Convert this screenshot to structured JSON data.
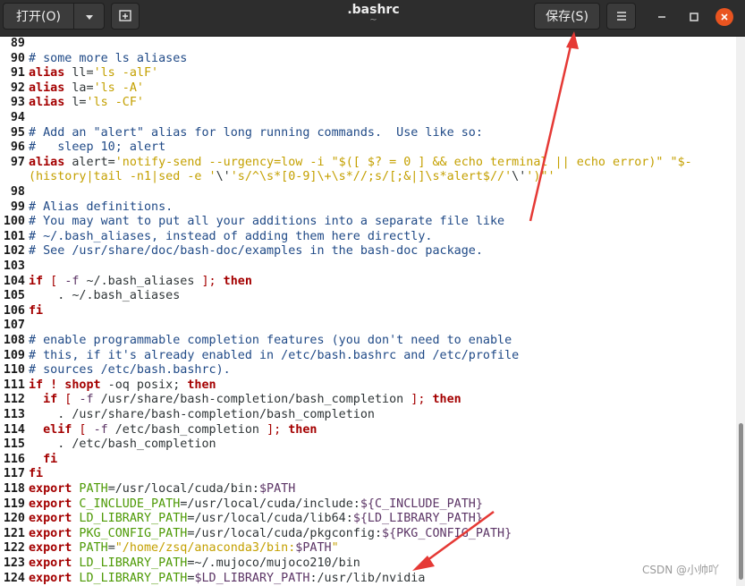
{
  "header": {
    "open_label": "打开(O)",
    "title": ".bashrc",
    "subtitle": "~",
    "save_label": "保存(S)"
  },
  "icons": {
    "open_dropdown": "chevron-down-icon",
    "new_tab": "new-tab-icon",
    "menu": "hamburger-menu-icon",
    "minimize": "minimize-icon",
    "maximize": "maximize-icon",
    "close": "close-icon"
  },
  "colors": {
    "titlebar": "#2d2d2d",
    "close_button": "#e95420",
    "arrow": "#e53935",
    "comment": "#204a87",
    "keyword": "#a40000",
    "string": "#c4a000",
    "variable": "#5c3566",
    "builtin": "#4e9a06"
  },
  "watermark": "CSDN @小帅吖",
  "lines": [
    {
      "n": "89",
      "t": []
    },
    {
      "n": "90",
      "t": [
        {
          "c": "c",
          "x": "# some more ls aliases"
        }
      ]
    },
    {
      "n": "91",
      "t": [
        {
          "c": "k",
          "x": "alias"
        },
        {
          "c": "",
          "x": " ll="
        },
        {
          "c": "s",
          "x": "'ls -alF'"
        }
      ]
    },
    {
      "n": "92",
      "t": [
        {
          "c": "k",
          "x": "alias"
        },
        {
          "c": "",
          "x": " la="
        },
        {
          "c": "s",
          "x": "'ls -A'"
        }
      ]
    },
    {
      "n": "93",
      "t": [
        {
          "c": "k",
          "x": "alias"
        },
        {
          "c": "",
          "x": " l="
        },
        {
          "c": "s",
          "x": "'ls -CF'"
        }
      ]
    },
    {
      "n": "94",
      "t": []
    },
    {
      "n": "95",
      "t": [
        {
          "c": "c",
          "x": "# Add an \"alert\" alias for long running commands.  Use like so:"
        }
      ]
    },
    {
      "n": "96",
      "t": [
        {
          "c": "c",
          "x": "#   sleep 10; alert"
        }
      ]
    },
    {
      "n": "97",
      "t": [
        {
          "c": "k",
          "x": "alias"
        },
        {
          "c": "",
          "x": " alert="
        },
        {
          "c": "s",
          "x": "'notify-send --urgency=low -i \"$([ $? = 0 ] && echo terminal || echo error)\" \"$-"
        }
      ]
    },
    {
      "n": "",
      "t": [
        {
          "c": "s",
          "x": "(history|tail -n1|sed -e '"
        },
        {
          "c": "",
          "x": "\\'"
        },
        {
          "c": "s",
          "x": "'s/^\\s*[0-9]\\+\\s*//;s/[;&|]\\s*alert$//'"
        },
        {
          "c": "",
          "x": "\\'"
        },
        {
          "c": "s",
          "x": "')\"'"
        }
      ]
    },
    {
      "n": "98",
      "t": []
    },
    {
      "n": "99",
      "t": [
        {
          "c": "c",
          "x": "# Alias definitions."
        }
      ]
    },
    {
      "n": "100",
      "t": [
        {
          "c": "c",
          "x": "# You may want to put all your additions into a separate file like"
        }
      ]
    },
    {
      "n": "101",
      "t": [
        {
          "c": "c",
          "x": "# ~/.bash_aliases, instead of adding them here directly."
        }
      ]
    },
    {
      "n": "102",
      "t": [
        {
          "c": "c",
          "x": "# See /usr/share/doc/bash-doc/examples in the bash-doc package."
        }
      ]
    },
    {
      "n": "103",
      "t": []
    },
    {
      "n": "104",
      "t": [
        {
          "c": "k",
          "x": "if"
        },
        {
          "c": "p",
          "x": " [ "
        },
        {
          "c": "v",
          "x": "-f"
        },
        {
          "c": "",
          "x": " ~/.bash_aliases "
        },
        {
          "c": "p",
          "x": "];"
        },
        {
          "c": "k",
          "x": " then"
        }
      ]
    },
    {
      "n": "105",
      "t": [
        {
          "c": "",
          "x": "    . ~/.bash_aliases"
        }
      ]
    },
    {
      "n": "106",
      "t": [
        {
          "c": "k",
          "x": "fi"
        }
      ]
    },
    {
      "n": "107",
      "t": []
    },
    {
      "n": "108",
      "t": [
        {
          "c": "c",
          "x": "# enable programmable completion features (you don't need to enable"
        }
      ]
    },
    {
      "n": "109",
      "t": [
        {
          "c": "c",
          "x": "# this, if it's already enabled in /etc/bash.bashrc and /etc/profile"
        }
      ]
    },
    {
      "n": "110",
      "t": [
        {
          "c": "c",
          "x": "# sources /etc/bash.bashrc)."
        }
      ]
    },
    {
      "n": "111",
      "t": [
        {
          "c": "k",
          "x": "if ! shopt"
        },
        {
          "c": "",
          "x": " -oq posix; "
        },
        {
          "c": "k",
          "x": "then"
        }
      ]
    },
    {
      "n": "112",
      "t": [
        {
          "c": "k",
          "x": "  if"
        },
        {
          "c": "p",
          "x": " [ "
        },
        {
          "c": "v",
          "x": "-f"
        },
        {
          "c": "",
          "x": " /usr/share/bash-completion/bash_completion "
        },
        {
          "c": "p",
          "x": "];"
        },
        {
          "c": "k",
          "x": " then"
        }
      ]
    },
    {
      "n": "113",
      "t": [
        {
          "c": "",
          "x": "    . /usr/share/bash-completion/bash_completion"
        }
      ]
    },
    {
      "n": "114",
      "t": [
        {
          "c": "k",
          "x": "  elif"
        },
        {
          "c": "p",
          "x": " [ "
        },
        {
          "c": "v",
          "x": "-f"
        },
        {
          "c": "",
          "x": " /etc/bash_completion "
        },
        {
          "c": "p",
          "x": "];"
        },
        {
          "c": "k",
          "x": " then"
        }
      ]
    },
    {
      "n": "115",
      "t": [
        {
          "c": "",
          "x": "    . /etc/bash_completion"
        }
      ]
    },
    {
      "n": "116",
      "t": [
        {
          "c": "k",
          "x": "  fi"
        }
      ]
    },
    {
      "n": "117",
      "t": [
        {
          "c": "k",
          "x": "fi"
        }
      ]
    },
    {
      "n": "118",
      "t": [
        {
          "c": "k",
          "x": "export"
        },
        {
          "c": "b",
          "x": " PATH"
        },
        {
          "c": "",
          "x": "=/usr/local/cuda/bin:"
        },
        {
          "c": "v",
          "x": "$PATH"
        }
      ]
    },
    {
      "n": "119",
      "t": [
        {
          "c": "k",
          "x": "export"
        },
        {
          "c": "b",
          "x": " C_INCLUDE_PATH"
        },
        {
          "c": "",
          "x": "=/usr/local/cuda/include:"
        },
        {
          "c": "v",
          "x": "${C_INCLUDE_PATH}"
        }
      ]
    },
    {
      "n": "120",
      "t": [
        {
          "c": "k",
          "x": "export"
        },
        {
          "c": "b",
          "x": " LD_LIBRARY_PATH"
        },
        {
          "c": "",
          "x": "=/usr/local/cuda/lib64:"
        },
        {
          "c": "v",
          "x": "${LD_LIBRARY_PATH}"
        }
      ]
    },
    {
      "n": "121",
      "t": [
        {
          "c": "k",
          "x": "export"
        },
        {
          "c": "b",
          "x": " PKG_CONFIG_PATH"
        },
        {
          "c": "",
          "x": "=/usr/local/cuda/pkgconfig:"
        },
        {
          "c": "v",
          "x": "${PKG_CONFIG_PATH}"
        }
      ]
    },
    {
      "n": "122",
      "t": [
        {
          "c": "k",
          "x": "export"
        },
        {
          "c": "b",
          "x": " PATH"
        },
        {
          "c": "",
          "x": "="
        },
        {
          "c": "s",
          "x": "\"/home/zsq/anaconda3/bin:"
        },
        {
          "c": "v",
          "x": "$PATH"
        },
        {
          "c": "s",
          "x": "\""
        }
      ]
    },
    {
      "n": "123",
      "t": [
        {
          "c": "k",
          "x": "export"
        },
        {
          "c": "b",
          "x": " LD_LIBRARY_PATH"
        },
        {
          "c": "",
          "x": "=~/.mujoco/mujoco210/bin"
        }
      ]
    },
    {
      "n": "124",
      "t": [
        {
          "c": "k",
          "x": "export"
        },
        {
          "c": "b",
          "x": " LD_LIBRARY_PATH"
        },
        {
          "c": "",
          "x": "="
        },
        {
          "c": "v",
          "x": "$LD_LIBRARY_PATH"
        },
        {
          "c": "",
          "x": ":/usr/lib/nvidia"
        }
      ]
    }
  ]
}
